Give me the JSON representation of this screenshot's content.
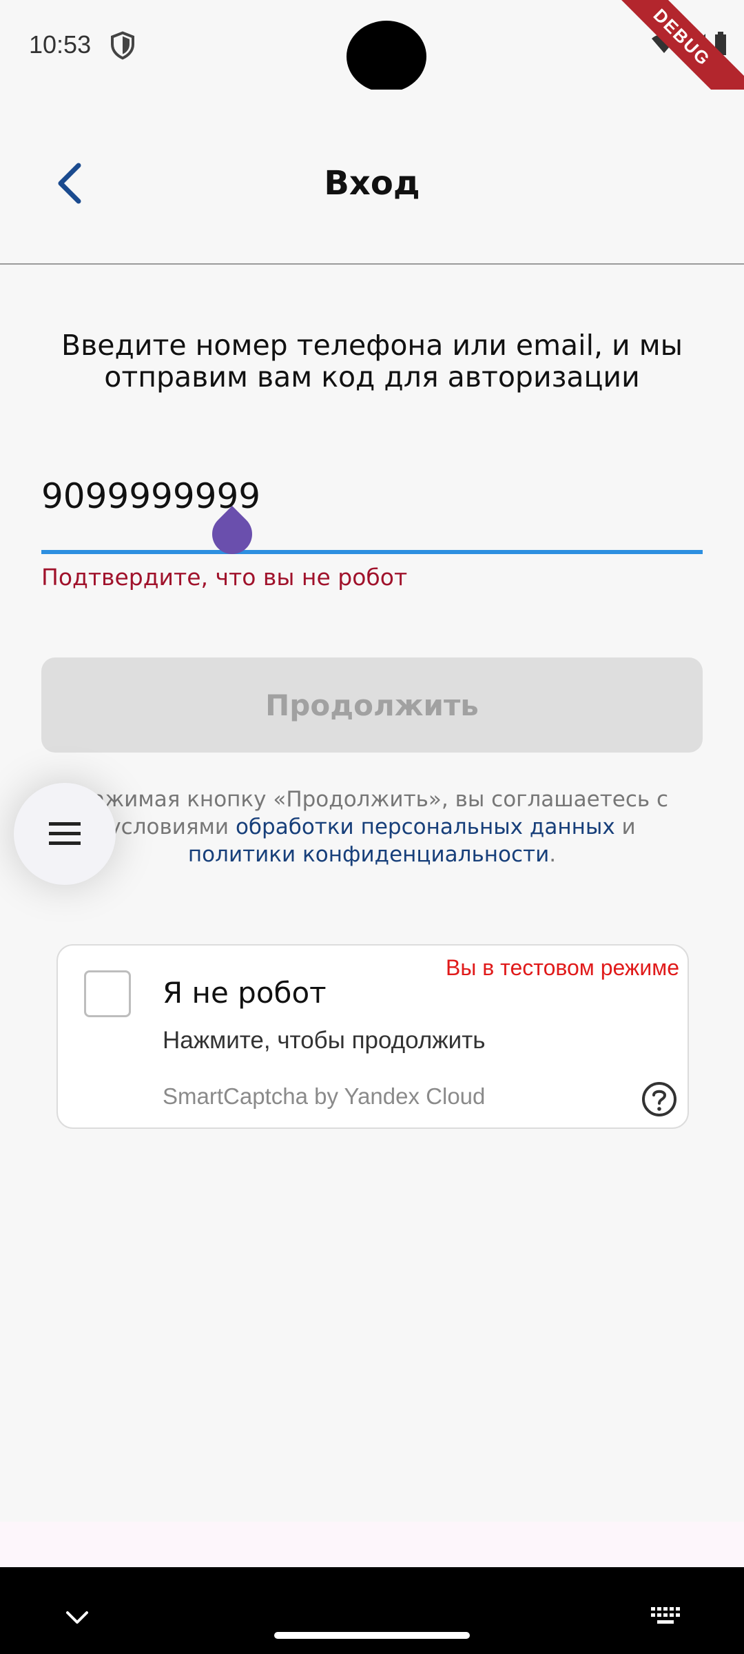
{
  "status_bar": {
    "time": "10:53",
    "debug_label": "DEBUG",
    "icons": [
      "shield-icon",
      "wifi-icon",
      "signal-icon",
      "battery-icon"
    ]
  },
  "app_bar": {
    "title": "Вход",
    "back_icon": "chevron-left-icon"
  },
  "instruction": "Введите номер телефона или email, и мы отправим вам код для авторизации",
  "phone_field": {
    "value": "9099999999",
    "error": "Подтвердите, что вы не робот"
  },
  "continue_button": {
    "label": "Продолжить",
    "state": "disabled"
  },
  "consent": {
    "prefix": "Нажимая кнопку «Продолжить», вы соглашаетесь с условиями ",
    "link1": "обработки персональных данных",
    "middle": " и ",
    "link2": "политики конфиденциальности",
    "suffix": "."
  },
  "menu_fab_icon": "menu-icon",
  "captcha": {
    "test_mode": "Вы в тестовом режиме",
    "title": "Я не робот",
    "subtitle": "Нажмите, чтобы продолжить",
    "brand": "SmartCaptcha by Yandex Cloud",
    "help_icon": "help-circle-icon",
    "checked": false
  },
  "colors": {
    "background": "#f7f7f7",
    "accent": "#1b4b8f",
    "error": "#a0122b",
    "input_underline": "#2d8fe0",
    "debug_ribbon": "#b3262d"
  }
}
